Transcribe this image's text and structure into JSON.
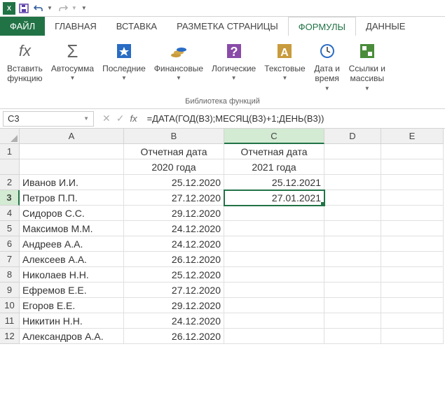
{
  "qat": {
    "app": "X"
  },
  "tabs": {
    "file": "ФАЙЛ",
    "home": "ГЛАВНАЯ",
    "insert": "ВСТАВКА",
    "layout": "РАЗМЕТКА СТРАНИЦЫ",
    "formulas": "ФОРМУЛЫ",
    "data": "ДАННЫЕ"
  },
  "ribbon": {
    "insert_fn": "Вставить\nфункцию",
    "autosum": "Автосумма",
    "recent": "Последние",
    "financial": "Финансовые",
    "logical": "Логические",
    "text": "Текстовые",
    "datetime": "Дата и\nвремя",
    "lookup": "Ссылки и\nмассивы",
    "group": "Библиотека функций"
  },
  "formula_bar": {
    "cell_ref": "C3",
    "formula": "=ДАТА(ГОД(B3);МЕСЯЦ(B3)+1;ДЕНЬ(B3))"
  },
  "columns": [
    "A",
    "B",
    "C",
    "D",
    "E"
  ],
  "header_row": {
    "b": "Отчетная дата 2020 года",
    "c": "Отчетная дата 2021 года"
  },
  "rows": [
    {
      "n": 1,
      "a": "",
      "b_top": "Отчетная дата",
      "c_top": "Отчетная дата"
    },
    {
      "n": 2,
      "a": "Иванов И.И.",
      "b": "25.12.2020",
      "c": "25.12.2021"
    },
    {
      "n": 3,
      "a": "Петров П.П.",
      "b": "27.12.2020",
      "c": "27.01.2021",
      "active": true
    },
    {
      "n": 4,
      "a": "Сидоров С.С.",
      "b": "29.12.2020",
      "c": ""
    },
    {
      "n": 5,
      "a": "Максимов М.М.",
      "b": "24.12.2020",
      "c": ""
    },
    {
      "n": 6,
      "a": "Андреев А.А.",
      "b": "24.12.2020",
      "c": ""
    },
    {
      "n": 7,
      "a": "Алексеев А.А.",
      "b": "26.12.2020",
      "c": ""
    },
    {
      "n": 8,
      "a": "Николаев Н.Н.",
      "b": "25.12.2020",
      "c": ""
    },
    {
      "n": 9,
      "a": "Ефремов Е.Е.",
      "b": "27.12.2020",
      "c": ""
    },
    {
      "n": 10,
      "a": "Егоров Е.Е.",
      "b": "29.12.2020",
      "c": ""
    },
    {
      "n": 11,
      "a": "Никитин Н.Н.",
      "b": "24.12.2020",
      "c": ""
    },
    {
      "n": 12,
      "a": "Александров А.А.",
      "b": "26.12.2020",
      "c": ""
    }
  ],
  "h1": {
    "b1": "Отчетная дата",
    "b2": "2020 года",
    "c1": "Отчетная дата",
    "c2": "2021 года"
  }
}
